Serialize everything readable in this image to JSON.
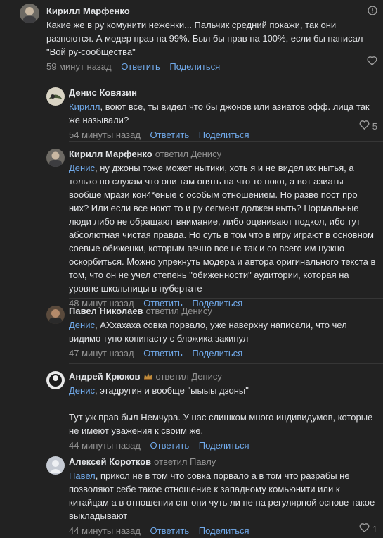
{
  "comments": [
    {
      "author": "Кирилл Марфенко",
      "text": "Какие же в ру комунити неженки... Пальчик средний покажи, так они разноются. А модер прав на 99%. Был бы прав на 100%, если бы написал \"Вой ру-сообщества\"",
      "time": "59 минут назад",
      "reply_label": "Ответить",
      "share_label": "Поделиться"
    },
    {
      "author": "Денис Ковязин",
      "mention": "Кирилл",
      "text": ", воют все, ты видел что бы джонов или азиатов офф. лица так же называли?",
      "time": "54 минуты назад",
      "reply_label": "Ответить",
      "share_label": "Поделиться",
      "likes": "5"
    },
    {
      "author": "Кирилл Марфенко",
      "replied_to": "ответил Денису",
      "mention": "Денис",
      "text": ", ну джоны тоже может нытики, хоть я и не видел их нытья, а только по слухам что они там опять на что то ноют, а вот азиаты вообще мрази кон4*еные с особым отношением. Но разве пост про них? Или если все ноют то и ру сегмент должен ныть? Нормальные люди либо не обращают внимание, либо оценивают подкол, ибо тут абсолютная чистая правда. Но суть в том что в игру играют в основном соевые обиженки, которым вечно все не так и со всего им нужно оскорбиться. Можно упрекнуть модера и автора оригинального текста в том, что он не учел степень \"обиженности\" аудитории, которая на уровне школьницы в пубертате",
      "time": "48 минут назад",
      "reply_label": "Ответить",
      "share_label": "Поделиться"
    },
    {
      "author": "Павел Николаев",
      "replied_to": "ответил Денису",
      "mention": "Денис",
      "text": ", АХхахаха совка порвало, уже наверхну написали, что чел видимо тупо копипасту с бложика закинул",
      "time": "47 минут назад",
      "reply_label": "Ответить",
      "share_label": "Поделиться"
    },
    {
      "author": "Андрей Крюков",
      "replied_to": "ответил Денису",
      "mention": "Денис",
      "text": ", этадругин и вообще \"ыыыы дзоны\"",
      "text2": "Тут уж прав был Немчура. У нас слишком много индивидумов, которые не имеют уважения к своим же.",
      "time": "44 минуты назад",
      "reply_label": "Ответить",
      "share_label": "Поделиться"
    },
    {
      "author": "Алексей Коротков",
      "replied_to": "ответил Павлу",
      "mention": "Павел",
      "text": ", прикол не в том что совка порвало а в том что разрабы не позволяют себе такое отношение к западному комьюнити или к китайцам а в отношении снг они чуть ли не на регулярной основе такое выкладывают",
      "time": "44 минуты назад",
      "reply_label": "Ответить",
      "share_label": "Поделиться",
      "likes": "1"
    }
  ],
  "colors": {
    "background": "#222222",
    "link": "#71aaeb",
    "muted": "#939393",
    "text": "#e1e3e6"
  },
  "icons": [
    "more-icon",
    "heart-icon",
    "crown-emoji-icon"
  ]
}
